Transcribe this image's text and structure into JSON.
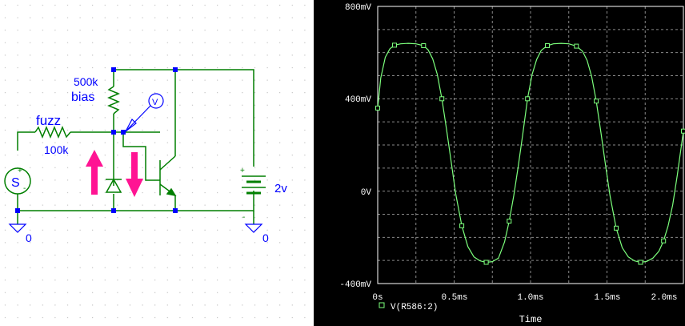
{
  "schematic": {
    "labels": {
      "fuzz": "fuzz",
      "resistor_fuzz_value": "100k",
      "resistor_bias_value": "500k",
      "bias": "bias",
      "source": "S",
      "source_plus": "+",
      "source_minus": "-",
      "battery_value": "2v",
      "battery_plus": "+",
      "battery_minus": "-",
      "ground_left": "0",
      "ground_right": "0",
      "voltage_probe": "V"
    },
    "colors": {
      "wire": "#007f00",
      "label": "#0000ff",
      "node": "#0000ff",
      "arrow": "#ff1493",
      "grid_dot": "#a8a8a8"
    }
  },
  "chart_data": {
    "type": "line",
    "title": "",
    "xlabel": "Time",
    "ylabel": "",
    "xlim": [
      0,
      2.0
    ],
    "ylim": [
      -400,
      800
    ],
    "x_unit": "ms",
    "y_unit": "mV",
    "x_ticks": [
      "0s",
      "0.5ms",
      "1.0ms",
      "1.5ms",
      "2.0ms"
    ],
    "y_ticks": [
      "800mV",
      "400mV",
      "0V",
      "-400mV"
    ],
    "grid": true,
    "legend_location": "bottom-left",
    "series": [
      {
        "name": "V(R586:2)",
        "color": "#7cff7c",
        "x": [
          0,
          0.02,
          0.05,
          0.08,
          0.11,
          0.15,
          0.2,
          0.25,
          0.3,
          0.33,
          0.36,
          0.39,
          0.42,
          0.45,
          0.48,
          0.51,
          0.55,
          0.59,
          0.63,
          0.67,
          0.71,
          0.75,
          0.79,
          0.83,
          0.86,
          0.89,
          0.92,
          0.95,
          0.98,
          1.01,
          1.04,
          1.07,
          1.11,
          1.15,
          1.2,
          1.25,
          1.3,
          1.34,
          1.37,
          1.4,
          1.43,
          1.46,
          1.49,
          1.52,
          1.56,
          1.6,
          1.64,
          1.68,
          1.72,
          1.76,
          1.8,
          1.84,
          1.87,
          1.9,
          1.93,
          1.96,
          2.0
        ],
        "y": [
          360,
          490,
          580,
          617,
          632,
          638,
          640,
          638,
          630,
          612,
          572,
          505,
          400,
          270,
          130,
          -10,
          -150,
          -240,
          -285,
          -302,
          -308,
          -305,
          -290,
          -220,
          -130,
          -20,
          110,
          250,
          400,
          505,
          570,
          610,
          630,
          638,
          640,
          638,
          628,
          606,
          566,
          496,
          390,
          255,
          115,
          -20,
          -160,
          -245,
          -285,
          -302,
          -308,
          -304,
          -290,
          -260,
          -215,
          -150,
          -60,
          70,
          260
        ]
      }
    ]
  }
}
